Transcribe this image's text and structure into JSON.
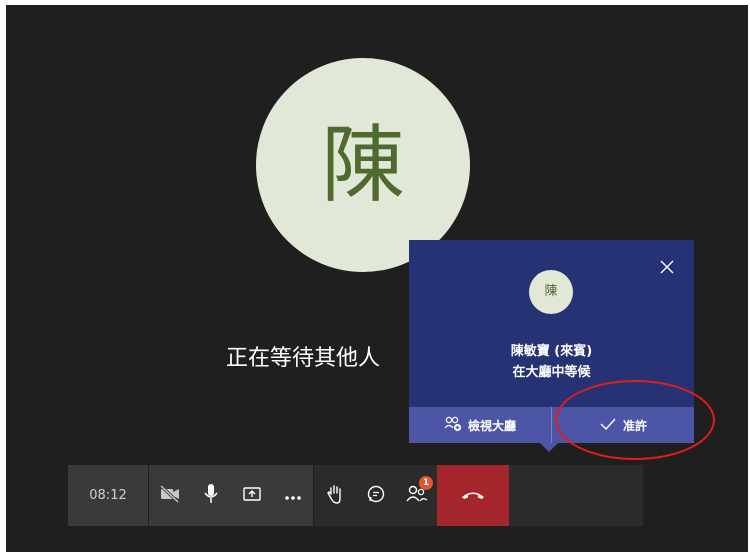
{
  "main": {
    "avatar_initial": "陳",
    "waiting_text": "正在等待其他人"
  },
  "lobby_popup": {
    "avatar_initial": "陳",
    "participant_name": "陳敏寶 (來賓)",
    "participant_status": "在大廳中等候",
    "view_lobby_label": "檢視大廳",
    "admit_label": "准許"
  },
  "toolbar": {
    "call_timer": "08:12",
    "participants_badge": "1",
    "buttons": [
      {
        "name": "camera-off-icon"
      },
      {
        "name": "microphone-icon"
      },
      {
        "name": "share-screen-icon"
      },
      {
        "name": "more-options-icon"
      },
      {
        "name": "raise-hand-icon"
      },
      {
        "name": "chat-icon"
      },
      {
        "name": "participants-icon"
      },
      {
        "name": "hang-up-icon"
      }
    ]
  },
  "colors": {
    "stage_background": "#201f1f",
    "avatar_background": "#e1e8d8",
    "avatar_text": "#4f6a2e",
    "popup_background": "#263274",
    "popup_action_bar": "#4d56a6",
    "hangup": "#a4262c",
    "badge": "#e2552c",
    "annotation": "#e61b1b"
  }
}
